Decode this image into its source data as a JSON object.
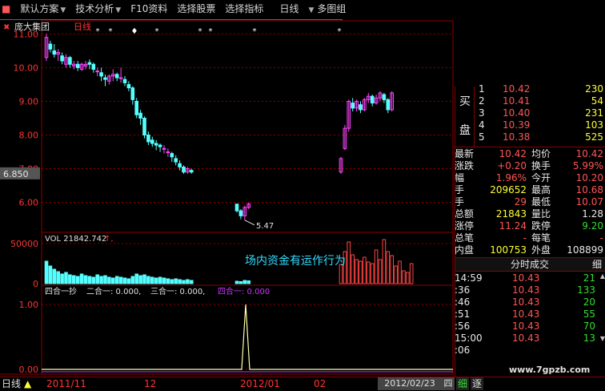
{
  "toolbar": {
    "items": [
      {
        "label": "默认方案",
        "dropdown": true
      },
      {
        "label": "技术分析",
        "dropdown": true
      },
      {
        "label": "F10资料",
        "dropdown": false
      },
      {
        "label": "选择股票",
        "dropdown": false
      },
      {
        "label": "选择指标",
        "dropdown": false
      },
      {
        "label": "日线",
        "dropdown": true
      },
      {
        "label": "多图组",
        "dropdown": false
      }
    ]
  },
  "main_chart": {
    "stock_name": "庞大集团",
    "period": "日线",
    "y_ticks": [
      "11.00",
      "10.00",
      "9.00",
      "8.00",
      "7.00",
      "6.00"
    ],
    "current_price_label": "6.850",
    "low_label": "5.47",
    "colors": {
      "up": "#ff44ff",
      "down": "#55ffff",
      "grid": "#8b0000",
      "axis_text": "#ff3333"
    }
  },
  "chart_data": {
    "type": "candlestick",
    "ylim": [
      5.3,
      11.2
    ],
    "candles_before_gap": [
      [
        10.3,
        10.9,
        10.2,
        11.0
      ],
      [
        10.7,
        10.55,
        10.45,
        10.8
      ],
      [
        10.5,
        10.4,
        10.3,
        10.7
      ],
      [
        10.4,
        10.45,
        10.2,
        10.55
      ],
      [
        10.35,
        10.2,
        10.1,
        10.45
      ],
      [
        10.1,
        10.3,
        10.0,
        10.4
      ],
      [
        10.3,
        10.1,
        10.0,
        10.35
      ],
      [
        10.05,
        10.1,
        9.95,
        10.2
      ],
      [
        10.1,
        10.0,
        9.9,
        10.2
      ],
      [
        9.95,
        10.1,
        9.9,
        10.15
      ],
      [
        10.05,
        10.1,
        9.95,
        10.2
      ],
      [
        10.15,
        10.1,
        9.95,
        10.25
      ],
      [
        10.1,
        9.95,
        9.85,
        10.15
      ],
      [
        9.9,
        9.9,
        9.75,
        10.0
      ],
      [
        9.85,
        9.75,
        9.6,
        10.0
      ],
      [
        9.7,
        9.65,
        9.45,
        9.8
      ],
      [
        9.6,
        9.75,
        9.5,
        9.8
      ],
      [
        9.75,
        9.8,
        9.6,
        9.95
      ],
      [
        9.8,
        9.7,
        9.6,
        9.85
      ],
      [
        9.7,
        9.7,
        9.55,
        10.0
      ],
      [
        9.65,
        9.55,
        9.45,
        9.75
      ],
      [
        9.5,
        9.4,
        9.3,
        9.6
      ],
      [
        9.4,
        9.05,
        8.9,
        9.45
      ],
      [
        9.0,
        8.6,
        8.5,
        9.1
      ],
      [
        8.65,
        8.5,
        8.3,
        8.75
      ],
      [
        8.5,
        8.0,
        7.9,
        8.55
      ],
      [
        8.0,
        7.8,
        7.7,
        8.1
      ],
      [
        7.85,
        7.75,
        7.65,
        7.95
      ],
      [
        7.75,
        7.7,
        7.55,
        7.85
      ],
      [
        7.7,
        7.65,
        7.5,
        7.75
      ],
      [
        7.6,
        7.6,
        7.45,
        7.7
      ],
      [
        7.5,
        7.5,
        7.35,
        7.6
      ],
      [
        7.45,
        7.35,
        7.2,
        7.5
      ],
      [
        7.3,
        7.2,
        7.1,
        7.4
      ],
      [
        7.15,
        7.05,
        6.95,
        7.25
      ],
      [
        7.05,
        6.9,
        6.85,
        7.1
      ],
      [
        6.9,
        7.0,
        6.85,
        7.05
      ],
      [
        6.95,
        6.9,
        6.85,
        7.0
      ]
    ],
    "candles_after_gap": [
      [
        5.95,
        5.75,
        5.7,
        5.95
      ],
      [
        5.75,
        5.6,
        5.5,
        5.8
      ],
      [
        5.6,
        5.85,
        5.47,
        5.9
      ],
      [
        5.85,
        5.95,
        5.8,
        6.0
      ]
    ],
    "candles_rebound": [
      [
        6.9,
        7.3,
        6.85,
        7.35
      ],
      [
        7.6,
        8.2,
        7.55,
        8.3
      ],
      [
        8.2,
        9.0,
        8.1,
        9.05
      ],
      [
        8.95,
        8.8,
        8.7,
        9.1
      ],
      [
        8.8,
        9.0,
        8.7,
        9.05
      ],
      [
        8.9,
        8.75,
        8.65,
        9.0
      ],
      [
        8.75,
        9.05,
        8.7,
        9.1
      ],
      [
        9.05,
        9.15,
        8.95,
        9.25
      ],
      [
        9.15,
        8.95,
        8.85,
        9.2
      ],
      [
        8.95,
        9.1,
        8.9,
        9.2
      ],
      [
        9.1,
        9.25,
        9.0,
        9.3
      ],
      [
        9.2,
        9.05,
        8.95,
        9.25
      ],
      [
        9.05,
        8.75,
        8.65,
        9.1
      ],
      [
        8.75,
        9.25,
        8.7,
        9.3
      ]
    ]
  },
  "volume_chart": {
    "header": "VOL 21842.742",
    "header_arrow": "↑,",
    "annotation": "场内资金有运作行为",
    "y_ticks": [
      "50000",
      "0"
    ],
    "values_before": [
      28000,
      22000,
      18000,
      15000,
      12000,
      14000,
      11000,
      10000,
      9000,
      12000,
      10000,
      9000,
      8000,
      11000,
      9000,
      10000,
      8000,
      7000,
      9000,
      8000,
      7000,
      6000,
      9000,
      12000,
      10000,
      11000,
      9000,
      8000,
      7000,
      8000,
      7000,
      6000,
      5000,
      6000,
      5000,
      4000,
      5000,
      4000
    ],
    "values_after": [
      3000,
      2500,
      4000,
      3500
    ],
    "values_rebound": [
      24000,
      40000,
      52000,
      36000,
      30000,
      28000,
      33000,
      27000,
      25000,
      42000,
      30000,
      55000,
      40000,
      35000,
      22000,
      28000,
      16000,
      14000,
      25000
    ]
  },
  "indicator_chart": {
    "header_parts": [
      {
        "text": "四合一抄",
        "color": "#e0e0e0"
      },
      {
        "text": "二合一: 0.000,",
        "color": "#e0e0e0"
      },
      {
        "text": "三合一: 0.000,",
        "color": "#e0e0e0"
      },
      {
        "text": "四合一: 0.000",
        "color": "#cc33ff"
      }
    ],
    "y_ticks": [
      "1.00",
      "0.00"
    ],
    "signal_value": 1.0
  },
  "order_book": {
    "side_label_1": "买",
    "side_label_2": "盘",
    "rows": [
      {
        "level": "1",
        "price": "10.42",
        "vol": "230"
      },
      {
        "level": "2",
        "price": "10.41",
        "vol": "54"
      },
      {
        "level": "3",
        "price": "10.40",
        "vol": "231"
      },
      {
        "level": "4",
        "price": "10.39",
        "vol": "103"
      },
      {
        "level": "5",
        "price": "10.38",
        "vol": "525"
      }
    ]
  },
  "quote": {
    "rows": [
      {
        "l": "最新",
        "v": "10.42",
        "l2": "均价",
        "v2": "10.42"
      },
      {
        "l": "涨跌",
        "v": "+0.20",
        "l2": "换手",
        "v2": "5.99%"
      },
      {
        "l": "幅",
        "v": "1.96%",
        "l2": "今开",
        "v2": "10.20"
      },
      {
        "l": "手",
        "v": "209652",
        "l2": "最高",
        "v2": "10.68"
      },
      {
        "l": "手",
        "v": "29",
        "l2": "最低",
        "v2": "10.07"
      },
      {
        "l": "总额",
        "v": "21843",
        "l2": "量比",
        "v2": "1.28"
      },
      {
        "l": "涨停",
        "v": "11.24",
        "l2": "跌停",
        "v2": "9.20"
      },
      {
        "l": "总笔",
        "v": "-",
        "l2": "每笔",
        "v2": "-"
      },
      {
        "l": "内盘",
        "v": "100753",
        "l2": "外盘",
        "v2": "108899"
      }
    ]
  },
  "ticks": {
    "title": "分时成交",
    "btn": "细",
    "rows": [
      {
        "time": "14:59",
        "price": "10.43",
        "vol": "21"
      },
      {
        "time": ":36",
        "price": "10.43",
        "vol": "133"
      },
      {
        "time": ":46",
        "price": "10.43",
        "vol": "20"
      },
      {
        "time": ":51",
        "price": "10.43",
        "vol": "55"
      },
      {
        "time": ":56",
        "price": "10.43",
        "vol": "70"
      },
      {
        "time": "15:00",
        "price": "10.43",
        "vol": "13"
      },
      {
        "time": ":06",
        "price": "",
        "vol": ""
      }
    ]
  },
  "bottom_bar": {
    "period": "日线",
    "dates": [
      "2011/11",
      "12",
      "2012/01",
      "02"
    ],
    "current_date": "2012/02/23",
    "weekday": "四",
    "tab1": "细",
    "tab2": "逐",
    "watermark": "www.7gpzb.com"
  },
  "chart_markers": {
    "star": "*",
    "diamond": "♦"
  }
}
